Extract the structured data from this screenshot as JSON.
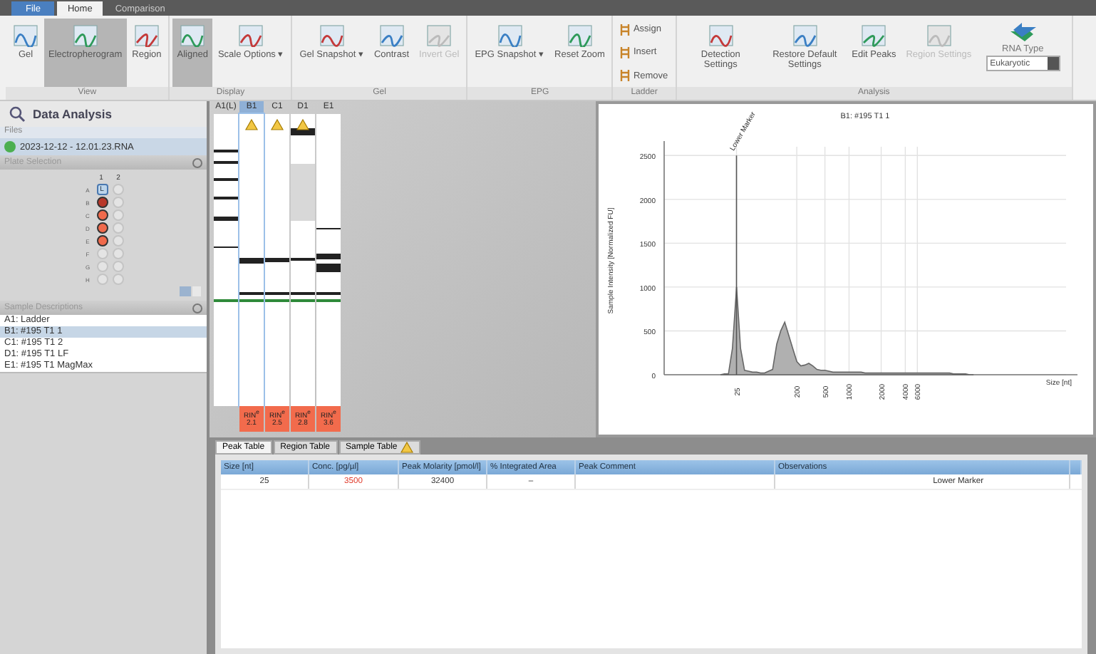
{
  "menu_tabs": [
    {
      "label": "File",
      "kind": "file",
      "selected": false
    },
    {
      "label": "Home",
      "kind": "tab",
      "selected": true
    },
    {
      "label": "Comparison",
      "kind": "tab",
      "selected": false
    }
  ],
  "ribbon": [
    {
      "label": "View",
      "buttons": [
        {
          "label": "Gel",
          "kind": "large",
          "selected": false,
          "disabled": false
        },
        {
          "label": "Electropherogram",
          "kind": "large",
          "selected": true,
          "disabled": false
        },
        {
          "label": "Region",
          "kind": "large",
          "selected": false,
          "disabled": false
        }
      ]
    },
    {
      "label": "Display",
      "buttons": [
        {
          "label": "Aligned",
          "kind": "large",
          "selected": true,
          "disabled": false
        },
        {
          "label": "Scale Options ▾",
          "kind": "large",
          "selected": false,
          "disabled": false
        }
      ]
    },
    {
      "label": "Gel",
      "buttons": [
        {
          "label": "Gel Snapshot ▾",
          "kind": "large",
          "selected": false,
          "disabled": false
        },
        {
          "label": "Contrast",
          "kind": "large",
          "selected": false,
          "disabled": false
        },
        {
          "label": "Invert Gel",
          "kind": "large",
          "selected": false,
          "disabled": true
        }
      ]
    },
    {
      "label": "EPG",
      "buttons": [
        {
          "label": "EPG Snapshot ▾",
          "kind": "large",
          "selected": false,
          "disabled": false
        },
        {
          "label": "Reset Zoom",
          "kind": "large",
          "selected": false,
          "disabled": false
        }
      ]
    },
    {
      "label": "Ladder",
      "buttons": [
        {
          "label": "Assign",
          "kind": "small",
          "selected": false,
          "disabled": false
        },
        {
          "label": "Insert",
          "kind": "small",
          "selected": false,
          "disabled": false
        },
        {
          "label": "Remove",
          "kind": "small",
          "selected": false,
          "disabled": false
        }
      ]
    },
    {
      "label": "Analysis",
      "buttons": [
        {
          "label": "Detection Settings",
          "kind": "large",
          "selected": false,
          "disabled": false
        },
        {
          "label": "Restore Default Settings",
          "kind": "large",
          "selected": false,
          "disabled": false
        },
        {
          "label": "Edit Peaks",
          "kind": "large",
          "selected": false,
          "disabled": false
        },
        {
          "label": "Region Settings",
          "kind": "large",
          "selected": false,
          "disabled": true
        },
        {
          "label": "RNA Type",
          "kind": "dropdown",
          "value": "Eukaryotic"
        }
      ]
    }
  ],
  "sidebar": {
    "title": "Data Analysis",
    "files_label": "Files",
    "file": "2023-12-12 - 12.01.23.RNA",
    "plate_label": "Plate Selection",
    "columns": [
      "1",
      "2"
    ],
    "wells": [
      {
        "row": "A",
        "color": "#bcd4ea",
        "label": "L"
      },
      {
        "row": "B",
        "color": "#b8382a"
      },
      {
        "row": "C",
        "color": "#f06a4c"
      },
      {
        "row": "D",
        "color": "#f06a4c"
      },
      {
        "row": "E",
        "color": "#f06a4c"
      },
      {
        "row": "F"
      },
      {
        "row": "G"
      },
      {
        "row": "H"
      }
    ],
    "samples_label": "Sample Descriptions",
    "samples": [
      {
        "label": "A1: Ladder",
        "selected": false
      },
      {
        "label": "B1: #195 T1 1",
        "selected": true
      },
      {
        "label": "C1: #195 T1 2",
        "selected": false
      },
      {
        "label": "D1: #195 T1 LF",
        "selected": false
      },
      {
        "label": "E1: #195 T1 MagMax",
        "selected": false
      }
    ]
  },
  "gel": {
    "lanes": [
      {
        "label": "A1(L)",
        "selected": false,
        "warning": false
      },
      {
        "label": "B1",
        "selected": true,
        "warning": true,
        "rin_label": "RIN$^{e}$",
        "rin": "2.1"
      },
      {
        "label": "C1",
        "selected": false,
        "warning": true,
        "rin_label": "RIN$^{e}$",
        "rin": "2.5"
      },
      {
        "label": "D1",
        "selected": false,
        "warning": true,
        "rin_label": "RIN$^{e}$",
        "rin": "2.8"
      },
      {
        "label": "E1",
        "selected": false,
        "warning": false,
        "rin_label": "RIN$^{e}$",
        "rin": "3.6"
      }
    ]
  },
  "electropherogram": {
    "chart_data": {
      "type": "area",
      "title": "B1: #195 T1 1",
      "ylabel": "Sample Intensity [Normalized FU]",
      "categories": [
        null,
        null,
        null,
        null,
        "25",
        null,
        null,
        null,
        null,
        null,
        null,
        null,
        null,
        null,
        null,
        null,
        null,
        null,
        null,
        "200",
        null,
        null,
        null,
        null,
        null,
        null,
        "500",
        null,
        null,
        null,
        null,
        null,
        "1000",
        null,
        null,
        null,
        null,
        null,
        null,
        null,
        "2000",
        null,
        null,
        null,
        null,
        null,
        "4000",
        null,
        null,
        "6000",
        null,
        null,
        null,
        null,
        null,
        null,
        null,
        null,
        null,
        null,
        null,
        null,
        null,
        null
      ],
      "series": [
        {
          "color": "#b0b0b0",
          "values": [
            0,
            10,
            10,
            300,
            1000,
            300,
            50,
            40,
            30,
            30,
            20,
            20,
            40,
            60,
            350,
            500,
            600,
            450,
            300,
            150,
            100,
            110,
            130,
            100,
            60,
            50,
            50,
            40,
            30,
            30,
            30,
            30,
            30,
            30,
            30,
            30,
            20,
            20,
            20,
            20,
            20,
            20,
            20,
            20,
            20,
            20,
            20,
            20,
            20,
            20,
            20,
            20,
            20,
            20,
            20,
            20,
            20,
            20,
            10,
            10,
            10,
            10,
            0,
            0
          ]
        }
      ],
      "ylim": [
        0,
        2600
      ],
      "grid": true,
      "yticks": [
        0,
        500,
        1000,
        1500,
        2000,
        2500
      ],
      "annotations": [
        "Lower Marker"
      ]
    },
    "axis_unit": "Size [nt]"
  },
  "bottom_tabs": [
    {
      "label": "Peak Table",
      "selected": true,
      "warning": false
    },
    {
      "label": "Region Table",
      "selected": false,
      "warning": false
    },
    {
      "label": "Sample Table",
      "selected": false,
      "warning": true
    }
  ],
  "peak_table": {
    "columns": [
      "Size [nt]",
      "Conc. [pg/µl]",
      "Peak Molarity [pmol/l]",
      "% Integrated Area",
      "Peak Comment",
      "Observations"
    ],
    "rows": [
      {
        "cells": [
          {
            "text": "25",
            "flagged": false
          },
          {
            "text": "3500",
            "flagged": true
          },
          {
            "text": "32400",
            "flagged": false
          },
          {
            "text": "–",
            "flagged": false
          },
          null,
          {
            "text": "Lower Marker",
            "flagged": false
          }
        ]
      }
    ]
  }
}
